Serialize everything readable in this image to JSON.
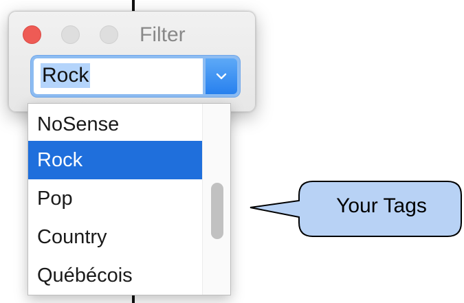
{
  "window": {
    "title": "Filter",
    "traffic_lights": {
      "close_color": "#ee5b55",
      "inactive_color": "#dedede"
    }
  },
  "combo": {
    "value": "Rock",
    "chevron_icon": "chevron-down-icon",
    "accent_color": "#2780ee"
  },
  "dropdown": {
    "items": [
      {
        "label": "NoSense"
      },
      {
        "label": "Rock",
        "selected": true
      },
      {
        "label": "Pop"
      },
      {
        "label": "Country"
      },
      {
        "label": "Québécois"
      }
    ],
    "selection_color": "#1f6fdc"
  },
  "callout": {
    "text": "Your Tags",
    "fill_color": "#b8d2f5"
  }
}
